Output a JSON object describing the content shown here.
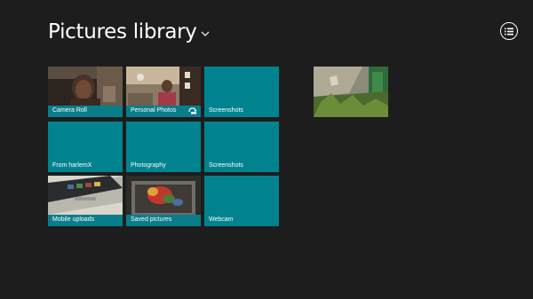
{
  "header": {
    "title": "Pictures library",
    "dropdown_icon": "chevron-down-icon",
    "view_button_icon": "list-view-icon"
  },
  "colors": {
    "background": "#1d1d1d",
    "tile": "#00838f",
    "text": "#ffffff"
  },
  "tiles": [
    {
      "label": "Camera Roll"
    },
    {
      "label": "Personal Photos",
      "badge_icon": "sync-icon"
    },
    {
      "label": "Screenshots"
    },
    {
      "label": "From harlemX"
    },
    {
      "label": "Photography"
    },
    {
      "label": "Screenshots"
    },
    {
      "label": "Mobile uploads"
    },
    {
      "label": "Saved pictures"
    },
    {
      "label": "Webcam"
    }
  ],
  "photo": {
    "icon": "photo-thumbnail"
  }
}
